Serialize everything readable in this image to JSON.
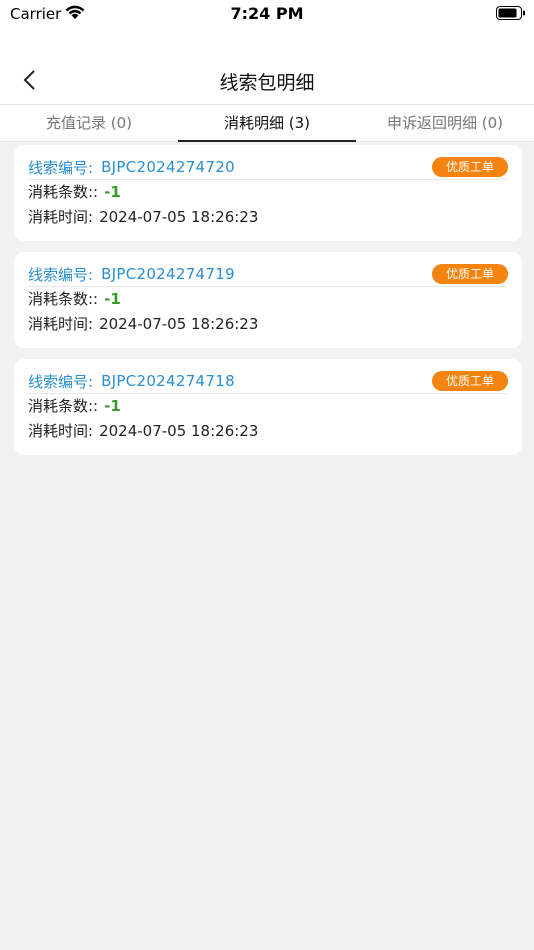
{
  "status_bar": {
    "carrier": "Carrier",
    "time": "7:24 PM"
  },
  "header": {
    "title": "线索包明细"
  },
  "tabs": [
    {
      "label": "充值记录 (0)",
      "active": false
    },
    {
      "label": "消耗明细 (3)",
      "active": true
    },
    {
      "label": "申诉返回明细 (0)",
      "active": false
    }
  ],
  "records": [
    {
      "lead_label": "线索编号:",
      "lead_no": "BJPC2024274720",
      "badge": "优质工单",
      "count_label": "消耗条数::",
      "count_value": "-1",
      "time_label": "消耗时间:",
      "time_value": "2024-07-05 18:26:23"
    },
    {
      "lead_label": "线索编号:",
      "lead_no": "BJPC2024274719",
      "badge": "优质工单",
      "count_label": "消耗条数::",
      "count_value": "-1",
      "time_label": "消耗时间:",
      "time_value": "2024-07-05 18:26:23"
    },
    {
      "lead_label": "线索编号:",
      "lead_no": "BJPC2024274718",
      "badge": "优质工单",
      "count_label": "消耗条数::",
      "count_value": "-1",
      "time_label": "消耗时间:",
      "time_value": "2024-07-05 18:26:23"
    }
  ],
  "colors": {
    "accent_blue": "#2a8fd0",
    "badge_orange": "#f5830f",
    "value_green": "#3a9a2a"
  }
}
